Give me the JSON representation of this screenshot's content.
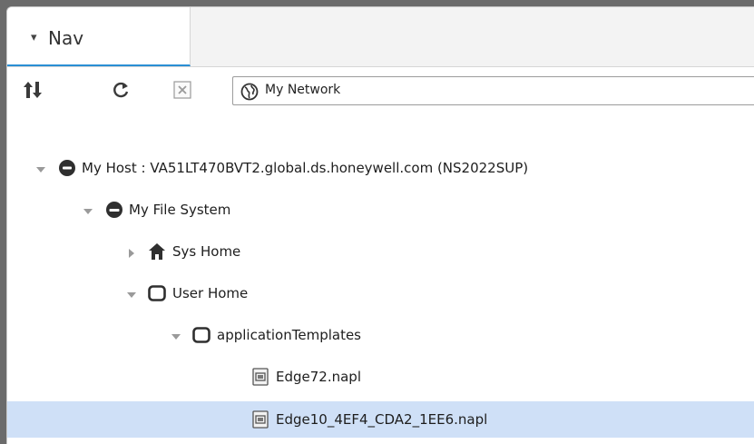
{
  "tab": {
    "label": "Nav",
    "caret": "▾"
  },
  "toolbar": {
    "ord_value": "My Network"
  },
  "tree": [
    {
      "label": "My Host : VA51LT470BVT2.global.ds.honeywell.com (NS2022SUP)",
      "icon": "host-icon",
      "expanded": true
    },
    {
      "label": "My File System",
      "icon": "drive-icon",
      "expanded": true
    },
    {
      "label": "Sys Home",
      "icon": "home-icon",
      "expanded": false
    },
    {
      "label": "User Home",
      "icon": "folder-icon",
      "expanded": true
    },
    {
      "label": "applicationTemplates",
      "icon": "folder-icon",
      "expanded": true
    },
    {
      "label": "Edge72.napl",
      "icon": "file-icon"
    },
    {
      "label": "Edge10_4EF4_CDA2_1EE6.napl",
      "icon": "file-icon",
      "selected": true
    }
  ]
}
